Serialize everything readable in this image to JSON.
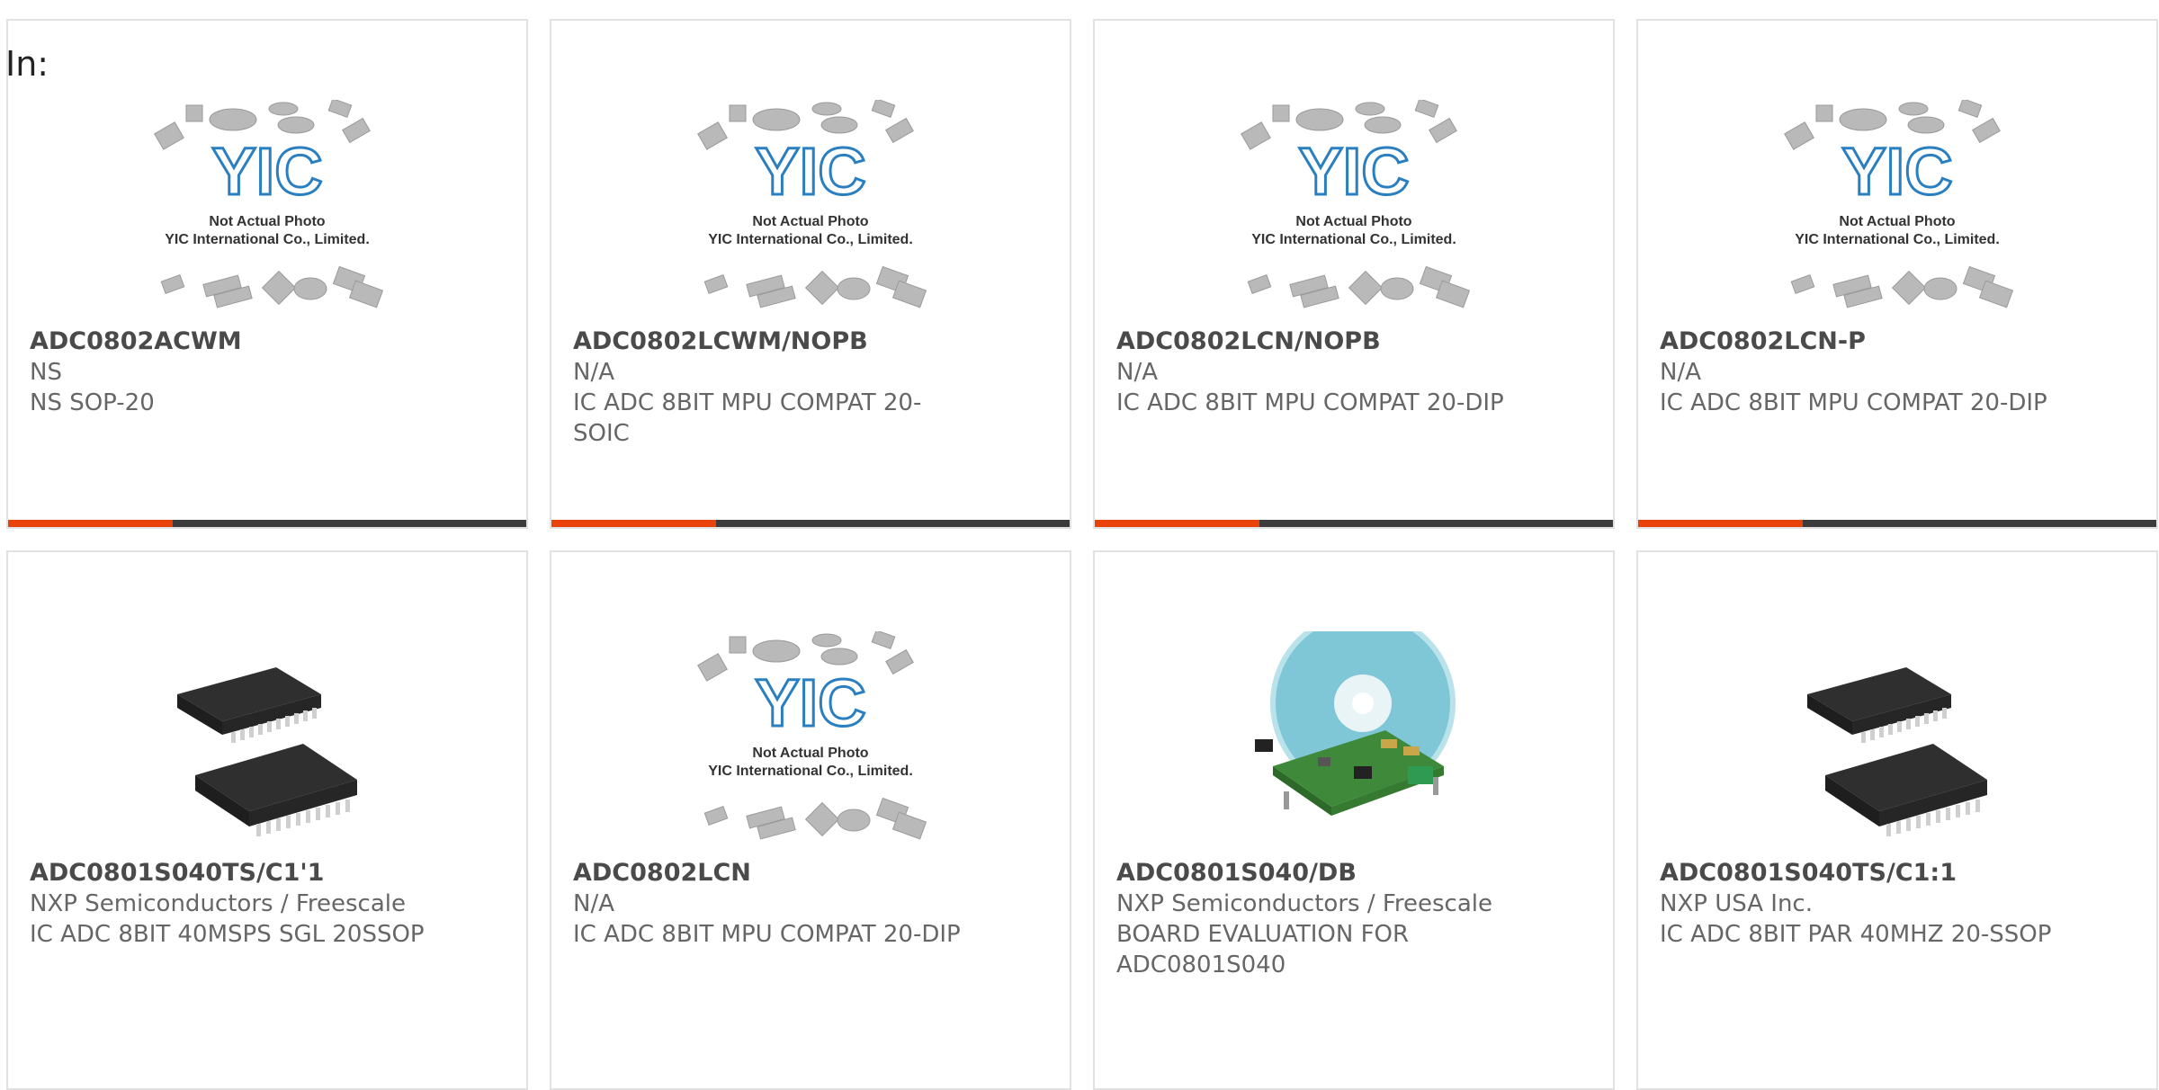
{
  "filter_label": "In:",
  "placeholder_image": {
    "caption_line1": "Not Actual Photo",
    "caption_line2": "YIC International Co., Limited.",
    "logo_text": "YIC"
  },
  "colors": {
    "accent": "#e8420a",
    "bar_dark": "#3c3c3c",
    "logo_blue": "#2a7fc1"
  },
  "products": [
    {
      "part": "ADC0802ACWM",
      "maker": "NS",
      "desc": "NS SOP-20",
      "image": "placeholder",
      "bar": true
    },
    {
      "part": "ADC0802LCWM/NOPB",
      "maker": "N/A",
      "desc": "IC ADC 8BIT MPU COMPAT 20-SOIC",
      "image": "placeholder",
      "bar": true
    },
    {
      "part": "ADC0802LCN/NOPB",
      "maker": "N/A",
      "desc": "IC ADC 8BIT MPU COMPAT 20-DIP",
      "image": "placeholder",
      "bar": true
    },
    {
      "part": "ADC0802LCN-P",
      "maker": "N/A",
      "desc": "IC ADC 8BIT MPU COMPAT 20-DIP",
      "image": "placeholder",
      "bar": true
    },
    {
      "part": "ADC0801S040TS/C1'1",
      "maker": "NXP Semiconductors / Freescale",
      "desc": "IC ADC 8BIT 40MSPS SGL 20SSOP",
      "image": "chip",
      "bar": false
    },
    {
      "part": "ADC0802LCN",
      "maker": "N/A",
      "desc": "IC ADC 8BIT MPU COMPAT 20-DIP",
      "image": "placeholder",
      "bar": false
    },
    {
      "part": "ADC0801S040/DB",
      "maker": "NXP Semiconductors / Freescale",
      "desc": "BOARD EVALUATION FOR ADC0801S040",
      "image": "board",
      "bar": false
    },
    {
      "part": "ADC0801S040TS/C1:1",
      "maker": "NXP USA Inc.",
      "desc": "IC ADC 8BIT PAR 40MHZ 20-SSOP",
      "image": "chip",
      "bar": false
    }
  ]
}
